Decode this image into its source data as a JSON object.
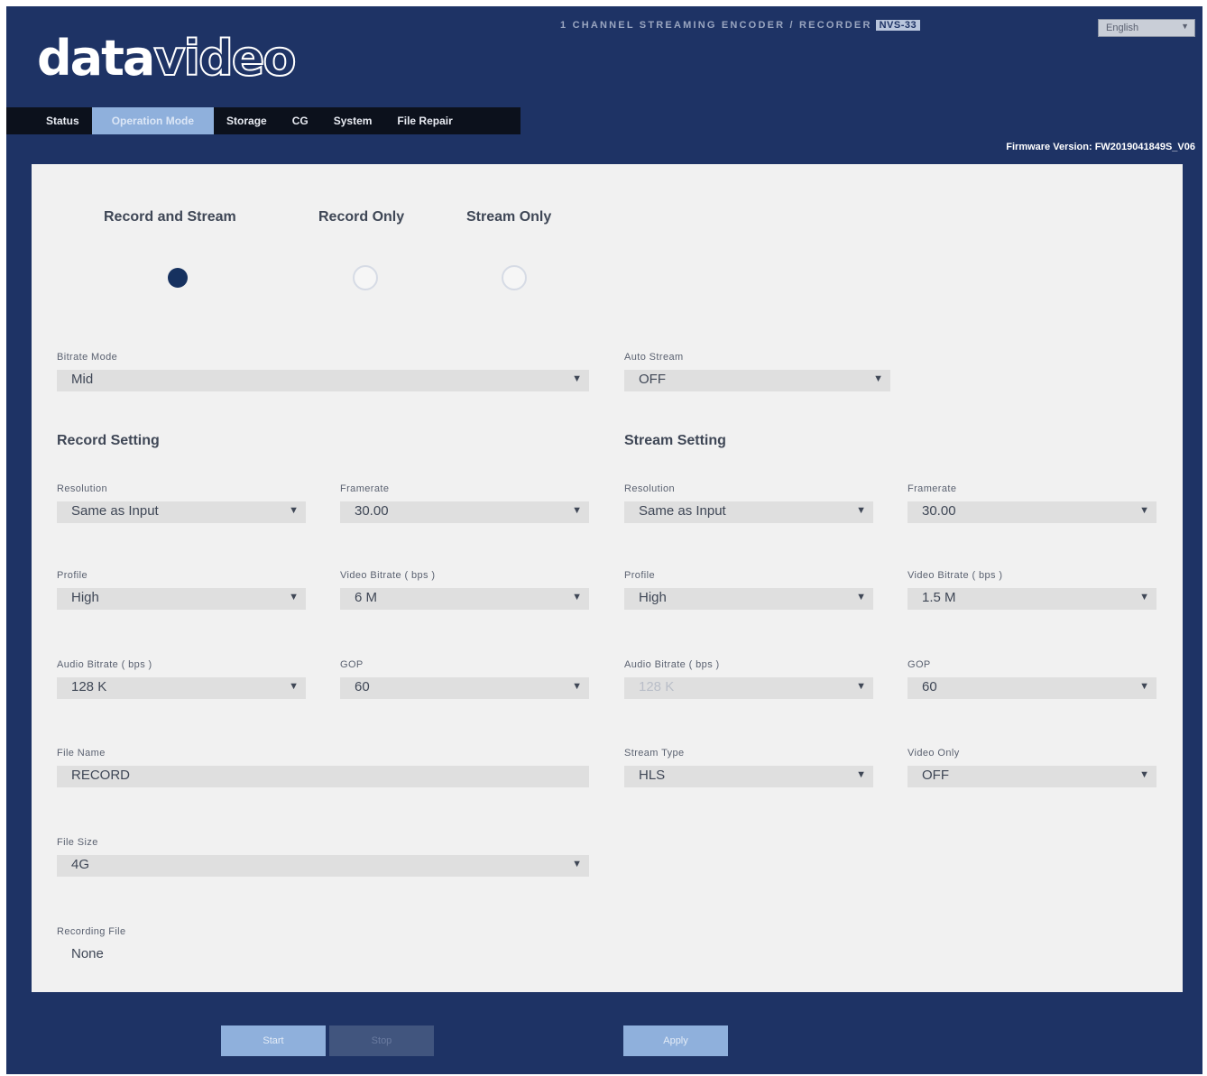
{
  "header": {
    "logo_bold": "data",
    "logo_light": "video",
    "product_title": "1 CHANNEL STREAMING ENCODER / RECORDER",
    "product_model": "NVS-33",
    "language": "English"
  },
  "nav": {
    "tabs": [
      "Status",
      "Operation Mode",
      "Storage",
      "CG",
      "System",
      "File Repair"
    ],
    "active_tab": "Operation Mode"
  },
  "firmware": "Firmware Version: FW2019041849S_V06",
  "modes": {
    "options": [
      "Record and Stream",
      "Record Only",
      "Stream Only"
    ],
    "selected": "Record and Stream"
  },
  "general": {
    "bitrate_mode_label": "Bitrate Mode",
    "bitrate_mode_value": "Mid",
    "auto_stream_label": "Auto Stream",
    "auto_stream_value": "OFF"
  },
  "record": {
    "title": "Record Setting",
    "resolution_label": "Resolution",
    "resolution_value": "Same as Input",
    "framerate_label": "Framerate",
    "framerate_value": "30.00",
    "profile_label": "Profile",
    "profile_value": "High",
    "video_bitrate_label": "Video Bitrate ( bps )",
    "video_bitrate_value": "6 M",
    "audio_bitrate_label": "Audio Bitrate ( bps )",
    "audio_bitrate_value": "128 K",
    "gop_label": "GOP",
    "gop_value": "60",
    "file_name_label": "File Name",
    "file_name_value": "RECORD",
    "file_size_label": "File Size",
    "file_size_value": "4G",
    "recording_file_label": "Recording File",
    "recording_file_value": "None"
  },
  "stream": {
    "title": "Stream Setting",
    "resolution_label": "Resolution",
    "resolution_value": "Same as Input",
    "framerate_label": "Framerate",
    "framerate_value": "30.00",
    "profile_label": "Profile",
    "profile_value": "High",
    "video_bitrate_label": "Video Bitrate ( bps )",
    "video_bitrate_value": "1.5 M",
    "audio_bitrate_label": "Audio Bitrate ( bps )",
    "audio_bitrate_value": "128 K",
    "gop_label": "GOP",
    "gop_value": "60",
    "stream_type_label": "Stream Type",
    "stream_type_value": "HLS",
    "video_only_label": "Video Only",
    "video_only_value": "OFF"
  },
  "buttons": {
    "start": "Start",
    "stop": "Stop",
    "apply": "Apply"
  },
  "colors": {
    "frame_bg": "#1e3365",
    "accent": "#8fb0dc",
    "nav_bg": "#0c111c",
    "panel_bg": "#f1f1f1",
    "radio_selected": "#16315f"
  }
}
